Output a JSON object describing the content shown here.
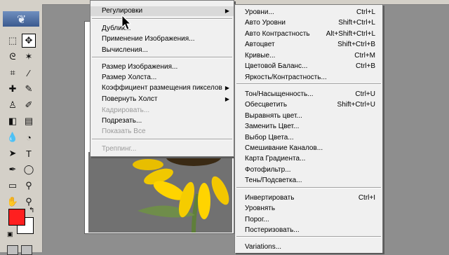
{
  "tools": [
    {
      "icon": "marquee-icon",
      "glyph": "⬚"
    },
    {
      "icon": "move-icon",
      "glyph": "✥"
    },
    {
      "icon": "lasso-icon",
      "glyph": "ᘓ"
    },
    {
      "icon": "magic-wand-icon",
      "glyph": "✶"
    },
    {
      "icon": "crop-icon",
      "glyph": "⌗"
    },
    {
      "icon": "slice-icon",
      "glyph": "∕"
    },
    {
      "icon": "healing-brush-icon",
      "glyph": "✚"
    },
    {
      "icon": "brush-icon",
      "glyph": "✎"
    },
    {
      "icon": "clone-stamp-icon",
      "glyph": "♙"
    },
    {
      "icon": "history-brush-icon",
      "glyph": "✐"
    },
    {
      "icon": "eraser-icon",
      "glyph": "◧"
    },
    {
      "icon": "gradient-icon",
      "glyph": "▤"
    },
    {
      "icon": "blur-icon",
      "glyph": "💧"
    },
    {
      "icon": "dodge-icon",
      "glyph": "◔"
    },
    {
      "icon": "path-selection-icon",
      "glyph": "➤"
    },
    {
      "icon": "type-icon",
      "glyph": "T"
    },
    {
      "icon": "pen-icon",
      "glyph": "✒"
    },
    {
      "icon": "shape-icon",
      "glyph": "◯"
    },
    {
      "icon": "notes-icon",
      "glyph": "▭"
    },
    {
      "icon": "eyedropper-icon",
      "glyph": "⚲"
    },
    {
      "icon": "hand-icon",
      "glyph": "✋"
    },
    {
      "icon": "zoom-icon",
      "glyph": "⚲"
    }
  ],
  "colors": {
    "foreground": "#ff1f1f",
    "background": "#ffffff"
  },
  "image_menu": {
    "items": [
      {
        "label": "Регулировки",
        "submenu": true,
        "highlighted": true,
        "disabled": false
      },
      {
        "label": "Дублик...",
        "submenu": false,
        "disabled": false
      },
      {
        "label": "Применение Изображения...",
        "submenu": false,
        "disabled": false
      },
      {
        "label": "Вычисления...",
        "submenu": false,
        "disabled": false
      },
      {
        "label": "Размер Изображения...",
        "submenu": false,
        "disabled": false
      },
      {
        "label": "Размер Холста...",
        "submenu": false,
        "disabled": false
      },
      {
        "label": "Коэффициент размещения пикселов",
        "submenu": true,
        "disabled": false
      },
      {
        "label": "Повернуть Холст",
        "submenu": true,
        "disabled": false
      },
      {
        "label": "Кадрировать...",
        "submenu": false,
        "disabled": true
      },
      {
        "label": "Подрезать...",
        "submenu": false,
        "disabled": false
      },
      {
        "label": "Показать Все",
        "submenu": false,
        "disabled": true
      },
      {
        "label": "Треппинг...",
        "submenu": false,
        "disabled": true
      }
    ]
  },
  "adjustments_menu": {
    "items": [
      {
        "label": "Уровни...",
        "shortcut": "Ctrl+L"
      },
      {
        "label": "Авто Уровни",
        "shortcut": "Shift+Ctrl+L"
      },
      {
        "label": "Авто Контрастность",
        "shortcut": "Alt+Shift+Ctrl+L"
      },
      {
        "label": "Автоцвет",
        "shortcut": "Shift+Ctrl+B"
      },
      {
        "label": "Кривые...",
        "shortcut": "Ctrl+M"
      },
      {
        "label": "Цветовой Баланс...",
        "shortcut": "Ctrl+B"
      },
      {
        "label": "Яркость/Контрастность...",
        "shortcut": ""
      },
      {
        "label": "Тон/Насыщенность...",
        "shortcut": "Ctrl+U"
      },
      {
        "label": "Обесцветить",
        "shortcut": "Shift+Ctrl+U"
      },
      {
        "label": "Выравнять цвет...",
        "shortcut": ""
      },
      {
        "label": "Заменить Цвет...",
        "shortcut": ""
      },
      {
        "label": "Выбор Цвета...",
        "shortcut": ""
      },
      {
        "label": "Смешивание Каналов...",
        "shortcut": ""
      },
      {
        "label": "Карта Градиента...",
        "shortcut": ""
      },
      {
        "label": "Фотофильтр...",
        "shortcut": ""
      },
      {
        "label": "Тень/Подсветка...",
        "shortcut": ""
      },
      {
        "label": "Инвертировать",
        "shortcut": "Ctrl+I"
      },
      {
        "label": "Уровнять",
        "shortcut": ""
      },
      {
        "label": "Порог...",
        "shortcut": ""
      },
      {
        "label": "Постеризовать...",
        "shortcut": ""
      },
      {
        "label": "Variations...",
        "shortcut": ""
      }
    ]
  }
}
